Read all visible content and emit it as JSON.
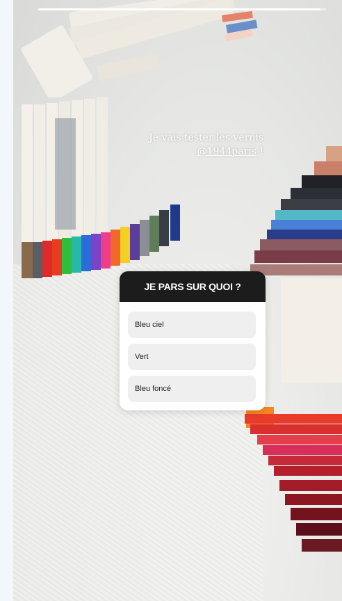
{
  "story": {
    "progress_fraction": 0.98,
    "caption": {
      "line1": "Je vais tester les vernis",
      "handle": "@1944paris",
      "suffix": " !"
    }
  },
  "quiz": {
    "question": "JE PARS SUR QUOI ?",
    "options": [
      "Bleu ciel",
      "Vert",
      "Bleu foncé"
    ]
  },
  "colors": {
    "quiz_header": "#1c1c1c",
    "quiz_option_bg": "#efefef",
    "progress": "#ffffff"
  },
  "icons": []
}
